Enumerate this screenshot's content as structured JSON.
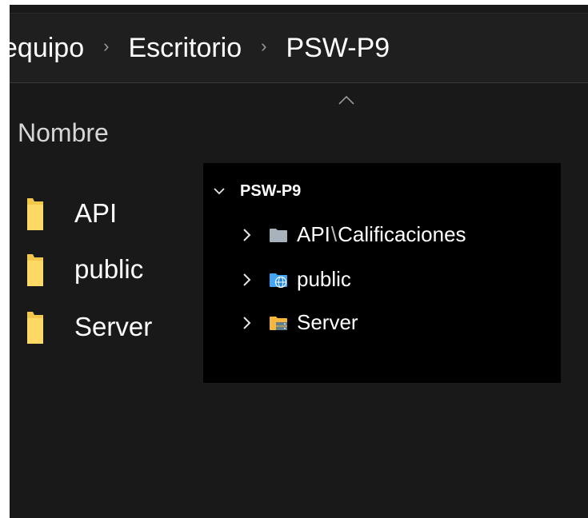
{
  "explorer": {
    "breadcrumb": [
      "equipo",
      "Escritorio",
      "PSW-P9"
    ],
    "breadcrumb_separator": "›",
    "column_header": "Nombre",
    "items": [
      {
        "label": "API",
        "icon": "folder-icon"
      },
      {
        "label": "public",
        "icon": "folder-icon"
      },
      {
        "label": "Server",
        "icon": "folder-icon"
      }
    ]
  },
  "vscode_explorer": {
    "root": "PSW-P9",
    "items": [
      {
        "label_part1": "API",
        "separator": "\\",
        "label_part2": "Calificaciones",
        "icon": "folder-icon"
      },
      {
        "label": "public",
        "icon": "folder-public-icon"
      },
      {
        "label": "Server",
        "icon": "folder-server-icon"
      }
    ]
  },
  "colors": {
    "folder_yellow": "#f3c94c",
    "vscode_folder_grey": "#a8b2bd",
    "vscode_folder_blue": "#42a5f5",
    "vscode_folder_server": "#f6b73c"
  }
}
